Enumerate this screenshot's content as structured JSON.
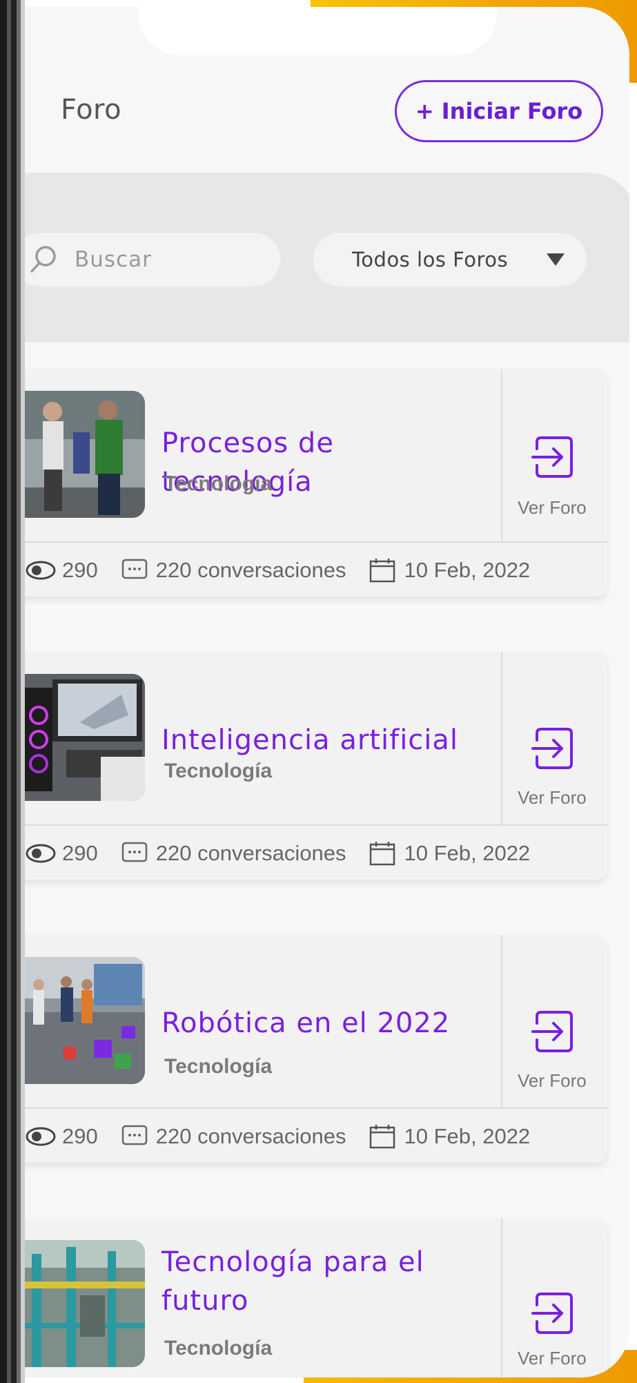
{
  "header": {
    "title": "Foro",
    "new_forum_button": "+ Iniciar Foro"
  },
  "filters": {
    "search_placeholder": "Buscar",
    "forum_filter_selected": "Todos los Foros"
  },
  "colors": {
    "accent": "#7a1fe0",
    "background_accent": "#f2a500"
  },
  "forums": [
    {
      "title": "Procesos de tecnología",
      "category": "Tecnología",
      "action": "Ver Foro",
      "views": "290",
      "conversations": "220 conversaciones",
      "date": "10 Feb, 2022"
    },
    {
      "title": "Inteligencia artificial",
      "category": "Tecnología",
      "action": "Ver Foro",
      "views": "290",
      "conversations": "220 conversaciones",
      "date": "10 Feb, 2022"
    },
    {
      "title": "Robótica en el 2022",
      "category": "Tecnología",
      "action": "Ver Foro",
      "views": "290",
      "conversations": "220 conversaciones",
      "date": "10 Feb, 2022"
    },
    {
      "title": "Tecnología para el futuro",
      "category": "Tecnología",
      "action": "Ver Foro"
    }
  ]
}
